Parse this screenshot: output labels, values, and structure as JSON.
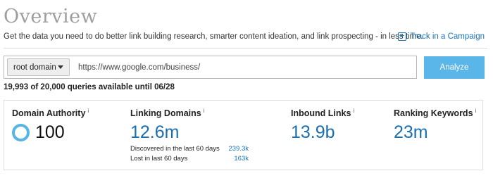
{
  "header": {
    "title": "Overview",
    "subtitle": "Get the data you need to do better link building research, smarter content ideation, and link prospecting - in less time.",
    "track_icon": "plus-box-icon",
    "track_label": "Track in a Campaign"
  },
  "search": {
    "scope_label": "root domain",
    "url_value": "https://www.google.com/business/",
    "analyze_label": "Analyze",
    "quota_text": "19,993 of 20,000 queries available until 06/28"
  },
  "metrics": {
    "domain_authority": {
      "label": "Domain Authority",
      "info": "i",
      "value": "100"
    },
    "linking_domains": {
      "label": "Linking Domains",
      "info": "i",
      "value": "12.6m",
      "discovered_label": "Discovered in the last 60 days",
      "discovered_value": "239.3k",
      "lost_label": "Lost in last 60 days",
      "lost_value": "163k"
    },
    "inbound_links": {
      "label": "Inbound Links",
      "info": "i",
      "value": "13.9b"
    },
    "ranking_keywords": {
      "label": "Ranking Keywords",
      "info": "i",
      "value": "23m"
    }
  },
  "colors": {
    "accent_blue": "#1a6faf",
    "button_blue": "#5ab5e8",
    "title_gray": "#9e9e9e"
  }
}
